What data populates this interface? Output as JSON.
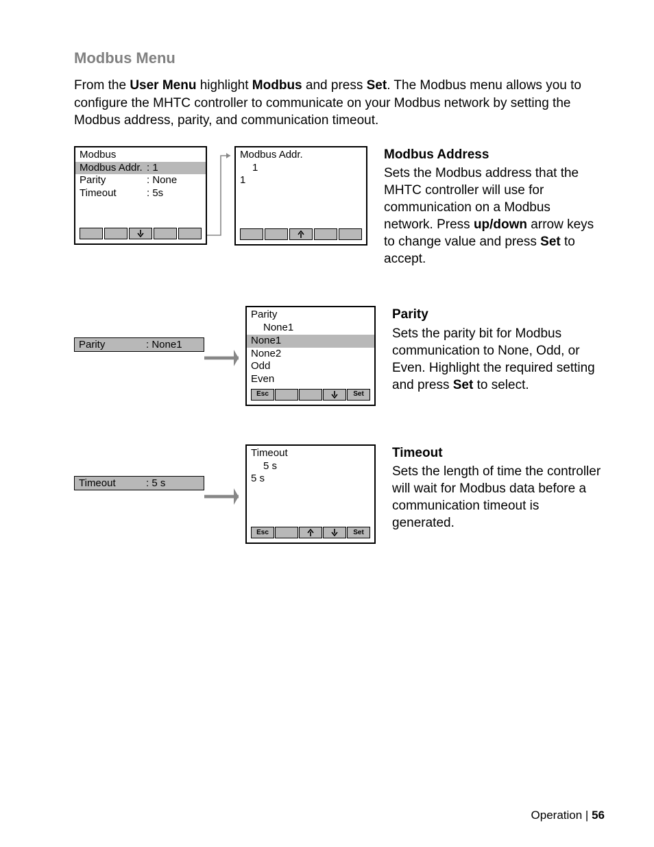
{
  "title": "Modbus Menu",
  "intro": {
    "pre": "From the ",
    "b1": "User Menu",
    "mid1": " highlight ",
    "b2": "Modbus",
    "mid2": " and press ",
    "b3": "Set",
    "post": ".  The Modbus menu allows you to configure the MHTC controller to communicate on your Modbus network by setting the Modbus address, parity, and communication timeout."
  },
  "row1": {
    "left_title": "Modbus",
    "left_items": [
      {
        "label": "Modbus Addr.",
        "value": ": 1",
        "sel": true
      },
      {
        "label": "Parity",
        "value": ": None",
        "sel": false
      },
      {
        "label": "Timeout",
        "value": ": 5s",
        "sel": false
      }
    ],
    "right_title": "Modbus Addr.",
    "right_value_top": "1",
    "right_value_cur": "1",
    "desc_hd": "Modbus Address",
    "desc_pre": "Sets the Modbus address that the MHTC controller will use for communication on a Modbus network.  Press ",
    "desc_b1": "up/down",
    "desc_mid": " arrow keys to change value and press ",
    "desc_b2": "Set",
    "desc_post": " to accept."
  },
  "row2": {
    "sel_label": "Parity",
    "sel_value": ": None1",
    "right_title": "Parity",
    "right_value_top": "None1",
    "options": [
      "None1",
      "None2",
      "Odd",
      "Even"
    ],
    "sel_option_index": 0,
    "buttons": {
      "esc": "Esc",
      "set": "Set"
    },
    "desc_hd": "Parity",
    "desc_pre": "Sets the parity bit for Modbus communication to None, Odd, or Even.  Highlight the required setting and press ",
    "desc_b1": "Set",
    "desc_post": " to select."
  },
  "row3": {
    "sel_label": "Timeout",
    "sel_value": ": 5 s",
    "right_title": "Timeout",
    "right_value_top": "5 s",
    "right_value_cur": "5 s",
    "buttons": {
      "esc": "Esc",
      "set": "Set"
    },
    "desc_hd": "Timeout",
    "desc_body": "Sets the length of time the controller will wait for Modbus data before a communication timeout is generated."
  },
  "footer": {
    "section": "Operation",
    "sep": " | ",
    "page": "56"
  }
}
